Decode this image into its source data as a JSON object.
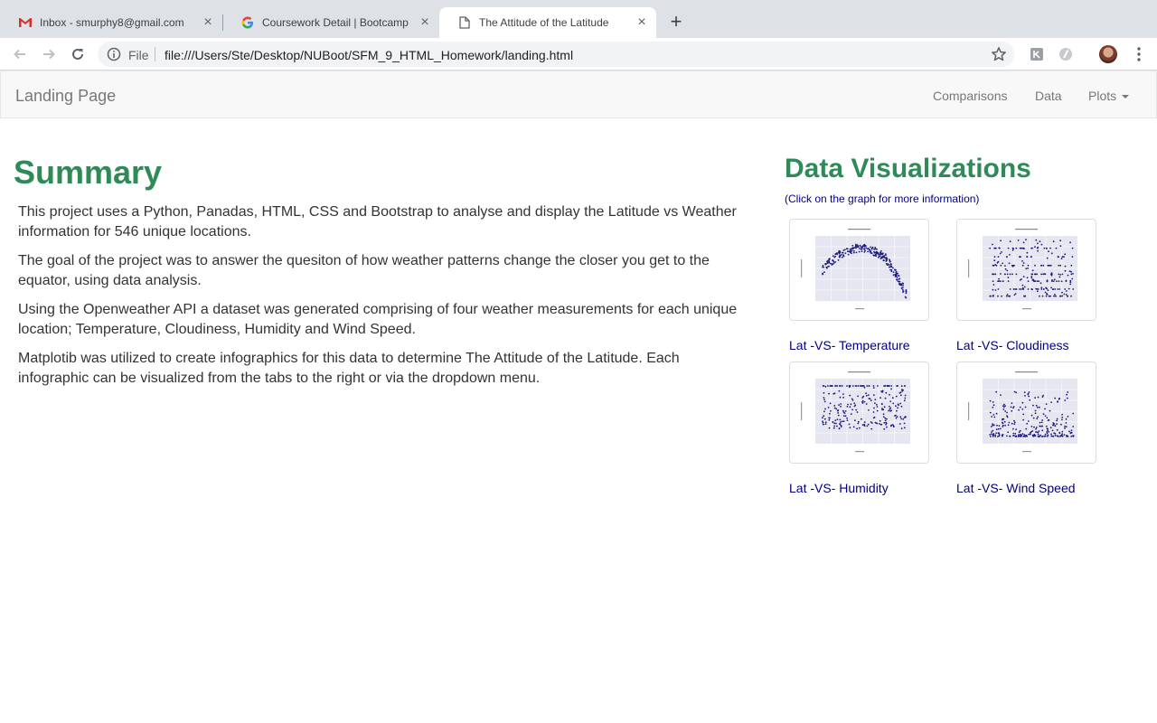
{
  "browser": {
    "tabs": [
      {
        "title": "Inbox - smurphy8@gmail.com",
        "icon": "gmail-icon"
      },
      {
        "title": "Coursework Detail | Bootcamp",
        "icon": "google-icon"
      },
      {
        "title": "The Attitude of the Latitude",
        "icon": "document-icon"
      }
    ],
    "close_glyph": "×",
    "new_tab_glyph": "+",
    "scheme": "File",
    "url": "file:///Users/Ste/Desktop/NUBoot/SFM_9_HTML_Homework/landing.html"
  },
  "navbar": {
    "brand": "Landing Page",
    "links": [
      "Comparisons",
      "Data",
      "Plots"
    ]
  },
  "summary": {
    "title": "Summary",
    "paragraphs": [
      "This project uses a Python, Panadas, HTML, CSS and Bootstrap to analyse and display the Latitude vs Weather information for 546 unique locations.",
      "The goal of the project was to answer the quesiton of how weather patterns change the closer you get to the equator, using data analysis.",
      "Using the Openweather API a dataset was generated comprising of four weather measurements for each unique location; Temperature, Cloudiness, Humidity and Wind Speed.",
      "Matplotib was utilized to create infographics for this data to determine The Attitude of the Latitude. Each infographic can be visualized from the tabs to the right or via the dropdown menu."
    ]
  },
  "visualizations": {
    "title": "Data Visualizations",
    "subtitle": "(Click on the graph for more information)",
    "items": [
      {
        "label": "Lat -VS- Temperature"
      },
      {
        "label": "Lat -VS- Cloudiness"
      },
      {
        "label": "Lat -VS- Humidity"
      },
      {
        "label": "Lat -VS- Wind Speed"
      }
    ]
  },
  "colors": {
    "heading_green": "#2e8b57",
    "link_navy": "#000080",
    "scatter_point": "#1a1a80",
    "plot_bg": "#e5e6f0"
  }
}
